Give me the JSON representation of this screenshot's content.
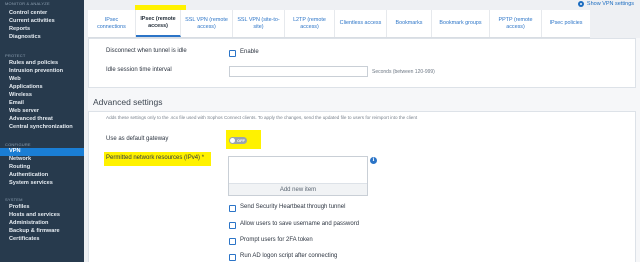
{
  "header": {
    "show_vpn_settings": "Show VPN settings"
  },
  "sidebar": {
    "sections": [
      {
        "title": "MONITOR & ANALYZE",
        "items": [
          "Control center",
          "Current activities",
          "Reports",
          "Diagnostics"
        ]
      },
      {
        "title": "PROTECT",
        "items": [
          "Rules and policies",
          "Intrusion prevention",
          "Web",
          "Applications",
          "Wireless",
          "Email",
          "Web server",
          "Advanced threat",
          "Central synchronization"
        ]
      },
      {
        "title": "CONFIGURE",
        "items": [
          "VPN",
          "Network",
          "Routing",
          "Authentication",
          "System services"
        ]
      },
      {
        "title": "SYSTEM",
        "items": [
          "Profiles",
          "Hosts and services",
          "Administration",
          "Backup & firmware",
          "Certificates"
        ]
      }
    ],
    "active_item": "VPN"
  },
  "tabs": [
    "IPsec connections",
    "IPsec (remote access)",
    "SSL VPN (remote access)",
    "SSL VPN (site-to-site)",
    "L2TP (remote access)",
    "Clientless access",
    "Bookmarks",
    "Bookmark groups",
    "PPTP (remote access)",
    "IPsec policies"
  ],
  "active_tab": "IPsec (remote access)",
  "form": {
    "disconnect_label": "Disconnect when tunnel is idle",
    "enable_label": "Enable",
    "idle_label": "Idle session time interval",
    "idle_value": "",
    "idle_hint": "Seconds (between 120-999)"
  },
  "advanced": {
    "title": "Advanced settings",
    "description": "Adds these settings only to the .scx file used with Sophos Connect clients. To apply the changes, send the updated file to users for reimport into the client",
    "default_gateway_label": "Use as default gateway",
    "toggle_state": "OFF",
    "permitted_label": "Permitted network resources (IPv4) *",
    "add_new_item": "Add new item",
    "options": [
      "Send Security Heartbeat through tunnel",
      "Allow users to save username and password",
      "Prompt users for 2FA token",
      "Run AD logon script after connecting"
    ]
  },
  "colors": {
    "highlight": "#fff200",
    "accent": "#2b74c7",
    "sidebar": "#273a4d"
  }
}
